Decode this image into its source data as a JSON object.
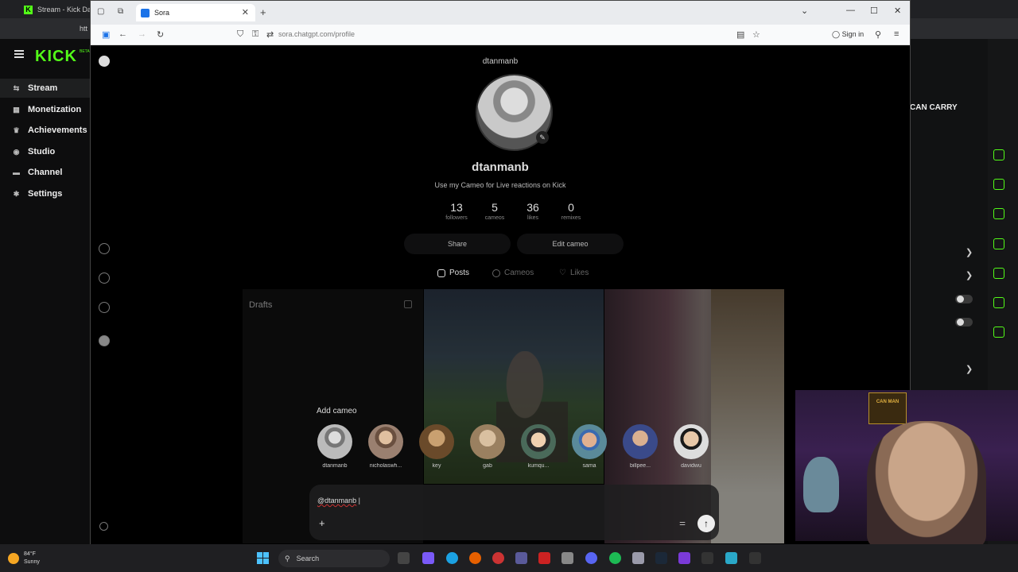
{
  "background_window": {
    "tab_title": "Stream - Kick Da",
    "address_partial": "htt",
    "brand": "KICK",
    "beta": "BETA",
    "nav": [
      {
        "label": "Stream",
        "icon": "stream-icon"
      },
      {
        "label": "Monetization",
        "icon": "monetization-icon"
      },
      {
        "label": "Achievements",
        "icon": "trophy-icon"
      },
      {
        "label": "Studio",
        "icon": "studio-icon"
      },
      {
        "label": "Channel",
        "icon": "channel-icon"
      },
      {
        "label": "Settings",
        "icon": "gear-icon"
      }
    ],
    "right_panel_text": "CAN CARRY",
    "accent": "#53fc18"
  },
  "browser": {
    "tab_title": "Sora",
    "url": "sora.chatgpt.com/profile",
    "sign_in": "Sign in"
  },
  "profile": {
    "username_top": "dtanmanb",
    "username": "dtanmanb",
    "bio": "Use my Cameo for Live reactions on Kick",
    "stats": [
      {
        "value": "13",
        "label": "followers"
      },
      {
        "value": "5",
        "label": "cameos"
      },
      {
        "value": "36",
        "label": "likes"
      },
      {
        "value": "0",
        "label": "remixes"
      }
    ],
    "share_label": "Share",
    "edit_label": "Edit cameo",
    "tabs": [
      "Posts",
      "Cameos",
      "Likes"
    ]
  },
  "drafts_title": "Drafts",
  "add_cameo_title": "Add cameo",
  "cameos": [
    "dtanmanb",
    "nicholaswh...",
    "key",
    "gab",
    "kumqu...",
    "sama",
    "billpee...",
    "davidwu"
  ],
  "composer": {
    "text": "@dtanmanb"
  },
  "webcam_sign": "CAN MAN",
  "taskbar": {
    "temp": "84°F",
    "condition": "Sunny",
    "search": "Search"
  }
}
